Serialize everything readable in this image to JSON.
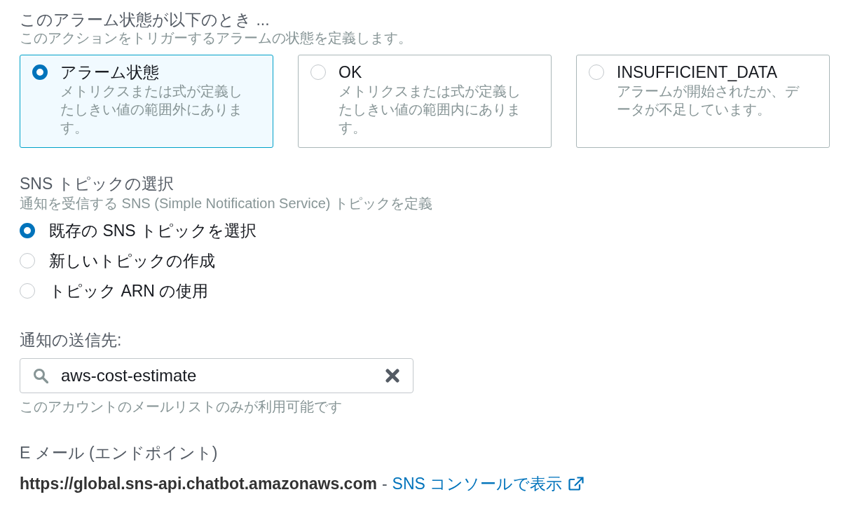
{
  "alarm_state": {
    "title": "このアラーム状態が以下のとき ...",
    "description": "このアクションをトリガーするアラームの状態を定義します。",
    "options": [
      {
        "label": "アラーム状態",
        "description": "メトリクスまたは式が定義したしきい値の範囲外にあります。",
        "selected": true
      },
      {
        "label": "OK",
        "description": "メトリクスまたは式が定義したしきい値の範囲内にあります。",
        "selected": false
      },
      {
        "label": "INSUFFICIENT_DATA",
        "description": "アラームが開始されたか、データが不足しています。",
        "selected": false
      }
    ]
  },
  "sns_topic": {
    "title": "SNS トピックの選択",
    "description": "通知を受信する SNS (Simple Notification Service) トピックを定義",
    "options": [
      {
        "label": "既存の SNS トピックを選択",
        "selected": true
      },
      {
        "label": "新しいトピックの作成",
        "selected": false
      },
      {
        "label": "トピック ARN の使用",
        "selected": false
      }
    ]
  },
  "notification_target": {
    "label": "通知の送信先:",
    "value": "aws-cost-estimate",
    "hint": "このアカウントのメールリストのみが利用可能です"
  },
  "email_endpoint": {
    "label": "E メール (エンドポイント)",
    "url": "https://global.sns-api.chatbot.amazonaws.com",
    "separator": "-",
    "link": "SNS コンソールで表示"
  }
}
